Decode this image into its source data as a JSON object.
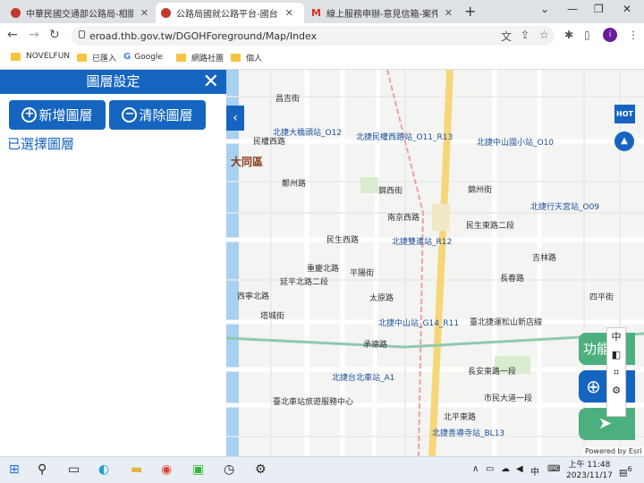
{
  "browser": {
    "tabs": [
      {
        "title": "中華民國交通部公路局-相關網站",
        "active": false
      },
      {
        "title": "公路局國就公路平台-國台",
        "active": true
      },
      {
        "title": "線上服務申辦-意見信箱-案件編號",
        "active": false
      }
    ],
    "url": "eroad.thb.gov.tw/DGOHForeground/Map/Index",
    "bookmarks": [
      "NOVELFUN",
      "已匯入",
      "Google",
      "網路社團",
      "個人"
    ],
    "avatar_letter": "i"
  },
  "panel": {
    "title": "圖層設定",
    "add_label": "新增圖層",
    "remove_label": "清除圖層",
    "selected_label": "已選擇圖層"
  },
  "map": {
    "district": "大同區",
    "hot_label": "HOT",
    "function_label": "功能",
    "zoom_label": "中",
    "attribution": "Powered by Esri",
    "labels": [
      {
        "text": "昌吉街"
      },
      {
        "text": "北捷大橋頭站_O12"
      },
      {
        "text": "北捷民權西路站_O11_R13"
      },
      {
        "text": "北捷中山國小站_O10"
      },
      {
        "text": "民權西路"
      },
      {
        "text": "鄭州路"
      },
      {
        "text": "錦西街"
      },
      {
        "text": "錦州街"
      },
      {
        "text": "北捷行天宮站_O09"
      },
      {
        "text": "南京西路"
      },
      {
        "text": "民生西路"
      },
      {
        "text": "民生東路二段"
      },
      {
        "text": "北捷雙連站_R12"
      },
      {
        "text": "吉林路"
      },
      {
        "text": "北捷中山站_G14_R11"
      },
      {
        "text": "臺北捷運松山新店線"
      },
      {
        "text": "長安東路一段"
      },
      {
        "text": "市民大道一段"
      },
      {
        "text": "北捷台北車站_A1"
      },
      {
        "text": "臺北車站旅遊服務中心"
      },
      {
        "text": "北捷善導寺站_BL13"
      },
      {
        "text": "北平東路"
      },
      {
        "text": "長春路"
      },
      {
        "text": "四平街"
      },
      {
        "text": "平陽街"
      },
      {
        "text": "太原路"
      },
      {
        "text": "承德路"
      },
      {
        "text": "重慶北路"
      },
      {
        "text": "延平北路二段"
      },
      {
        "text": "塔城街"
      },
      {
        "text": "西寧北路"
      }
    ]
  },
  "taskbar": {
    "time": "上午 11:48",
    "date": "2023/11/17",
    "ime": "中",
    "notify_count": "6"
  }
}
